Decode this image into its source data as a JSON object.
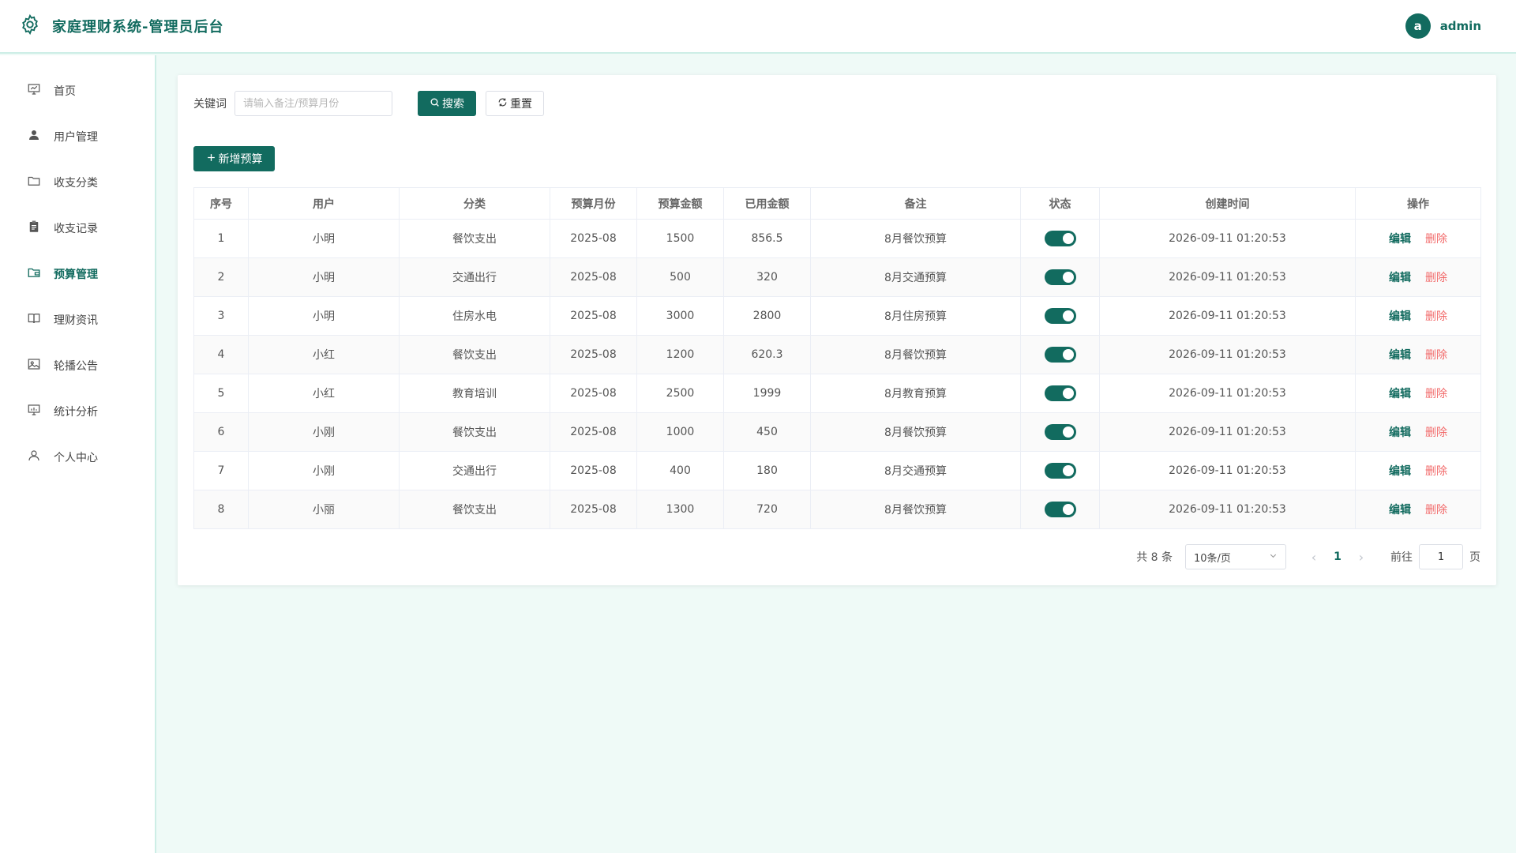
{
  "header": {
    "title": "家庭理财系统-管理员后台",
    "avatar_letter": "a",
    "username": "admin",
    "brand_color": "#126b5f"
  },
  "sidebar": {
    "items": [
      {
        "label": "首页",
        "icon": "presentation-icon",
        "active": false
      },
      {
        "label": "用户管理",
        "icon": "user-icon",
        "active": false
      },
      {
        "label": "收支分类",
        "icon": "folder-icon",
        "active": false
      },
      {
        "label": "收支记录",
        "icon": "clipboard-icon",
        "active": false
      },
      {
        "label": "预算管理",
        "icon": "wallet-folder-icon",
        "active": true
      },
      {
        "label": "理财资讯",
        "icon": "book-icon",
        "active": false
      },
      {
        "label": "轮播公告",
        "icon": "picture-icon",
        "active": false
      },
      {
        "label": "统计分析",
        "icon": "chart-board-icon",
        "active": false
      },
      {
        "label": "个人中心",
        "icon": "person-outline-icon",
        "active": false
      }
    ]
  },
  "search": {
    "label": "关键词",
    "placeholder": "请输入备注/预算月份",
    "value": "",
    "search_btn": "搜索",
    "reset_btn": "重置"
  },
  "toolbar": {
    "add_btn": "新增预算"
  },
  "table": {
    "headers": [
      "序号",
      "用户",
      "分类",
      "预算月份",
      "预算金额",
      "已用金额",
      "备注",
      "状态",
      "创建时间",
      "操作"
    ],
    "edit_label": "编辑",
    "delete_label": "删除",
    "rows": [
      {
        "no": "1",
        "user": "小明",
        "category": "餐饮支出",
        "month": "2025-08",
        "budget": "1500",
        "used": "856.5",
        "remark": "8月餐饮预算",
        "enabled": true,
        "created": "2026-09-11 01:20:53"
      },
      {
        "no": "2",
        "user": "小明",
        "category": "交通出行",
        "month": "2025-08",
        "budget": "500",
        "used": "320",
        "remark": "8月交通预算",
        "enabled": true,
        "created": "2026-09-11 01:20:53"
      },
      {
        "no": "3",
        "user": "小明",
        "category": "住房水电",
        "month": "2025-08",
        "budget": "3000",
        "used": "2800",
        "remark": "8月住房预算",
        "enabled": true,
        "created": "2026-09-11 01:20:53"
      },
      {
        "no": "4",
        "user": "小红",
        "category": "餐饮支出",
        "month": "2025-08",
        "budget": "1200",
        "used": "620.3",
        "remark": "8月餐饮预算",
        "enabled": true,
        "created": "2026-09-11 01:20:53"
      },
      {
        "no": "5",
        "user": "小红",
        "category": "教育培训",
        "month": "2025-08",
        "budget": "2500",
        "used": "1999",
        "remark": "8月教育预算",
        "enabled": true,
        "created": "2026-09-11 01:20:53"
      },
      {
        "no": "6",
        "user": "小刚",
        "category": "餐饮支出",
        "month": "2025-08",
        "budget": "1000",
        "used": "450",
        "remark": "8月餐饮预算",
        "enabled": true,
        "created": "2026-09-11 01:20:53"
      },
      {
        "no": "7",
        "user": "小刚",
        "category": "交通出行",
        "month": "2025-08",
        "budget": "400",
        "used": "180",
        "remark": "8月交通预算",
        "enabled": true,
        "created": "2026-09-11 01:20:53"
      },
      {
        "no": "8",
        "user": "小丽",
        "category": "餐饮支出",
        "month": "2025-08",
        "budget": "1300",
        "used": "720",
        "remark": "8月餐饮预算",
        "enabled": true,
        "created": "2026-09-11 01:20:53"
      }
    ]
  },
  "pagination": {
    "total_text": "共 8 条",
    "page_size": "10条/页",
    "current_page": "1",
    "goto_label": "前往",
    "goto_value": "1",
    "page_suffix": "页"
  }
}
